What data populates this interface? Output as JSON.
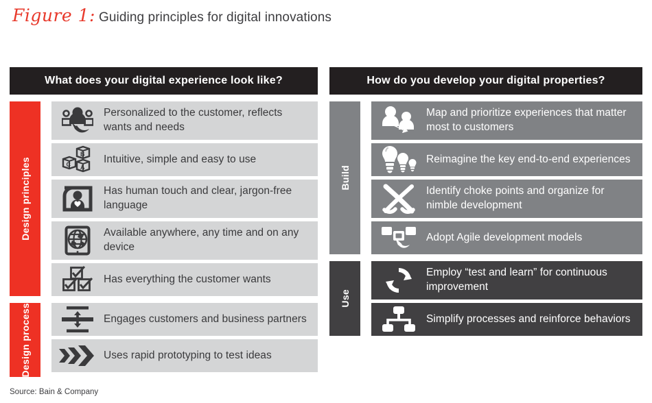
{
  "figure": {
    "label": "Figure 1:",
    "title": "Guiding principles for digital innovations"
  },
  "source": "Source: Bain & Company",
  "colors": {
    "red": "#ee3124",
    "dark": "#231f20",
    "row_gray": "#d4d5d6",
    "mid_gray": "#808285",
    "dark_gray": "#414042",
    "title_red": "#e8382a"
  },
  "left_column": {
    "header": "What does your digital experience look like?",
    "groups": [
      {
        "tab_label": "Design principles",
        "tab_style": "tab-red",
        "rows": [
          {
            "icon": "people-group-icon",
            "text": "Personalized to the customer, reflects wants and needs",
            "lines": 2
          },
          {
            "icon": "abc-blocks-icon",
            "text": "Intuitive, simple and easy to use",
            "lines": 1
          },
          {
            "icon": "person-heart-frame-icon",
            "text": "Has human touch and clear, jargon-free language",
            "lines": 2
          },
          {
            "icon": "tablet-globe-icon",
            "text": "Available anywhere, any time and on any device",
            "lines": 2
          },
          {
            "icon": "checkboxes-icon",
            "text": "Has everything the customer wants",
            "lines": 1
          }
        ]
      },
      {
        "tab_label": "Design process",
        "tab_style": "tab-red",
        "rows": [
          {
            "icon": "compress-arrows-icon",
            "text": "Engages customers and business partners",
            "lines": 1
          },
          {
            "icon": "triple-chevron-arrow-icon",
            "text": "Uses rapid prototyping to test ideas",
            "lines": 1
          }
        ]
      }
    ]
  },
  "right_column": {
    "header": "How do you develop your digital properties?",
    "groups": [
      {
        "tab_label": "Build",
        "tab_style": "tab-gray",
        "row_style": "row-midgray",
        "rows": [
          {
            "icon": "two-people-arrow-icon",
            "text": "Map and prioritize experiences that matter most to customers",
            "lines": 2
          },
          {
            "icon": "three-lightbulbs-icon",
            "text": "Reimagine the key end-to-end experiences",
            "lines": 1
          },
          {
            "icon": "crossed-x-icon",
            "text": "Identify choke points and organize for nimble development",
            "lines": 2
          },
          {
            "icon": "screens-arrow-icon",
            "text": "Adopt Agile development models",
            "lines": 1
          }
        ]
      },
      {
        "tab_label": "Use",
        "tab_style": "tab-darkgray",
        "row_style": "row-darkgray",
        "rows": [
          {
            "icon": "circular-refresh-icon",
            "text": "Employ “test and learn” for continuous improvement",
            "lines": 2
          },
          {
            "icon": "org-chart-icon",
            "text": "Simplify processes and reinforce behaviors",
            "lines": 1
          }
        ]
      }
    ]
  }
}
